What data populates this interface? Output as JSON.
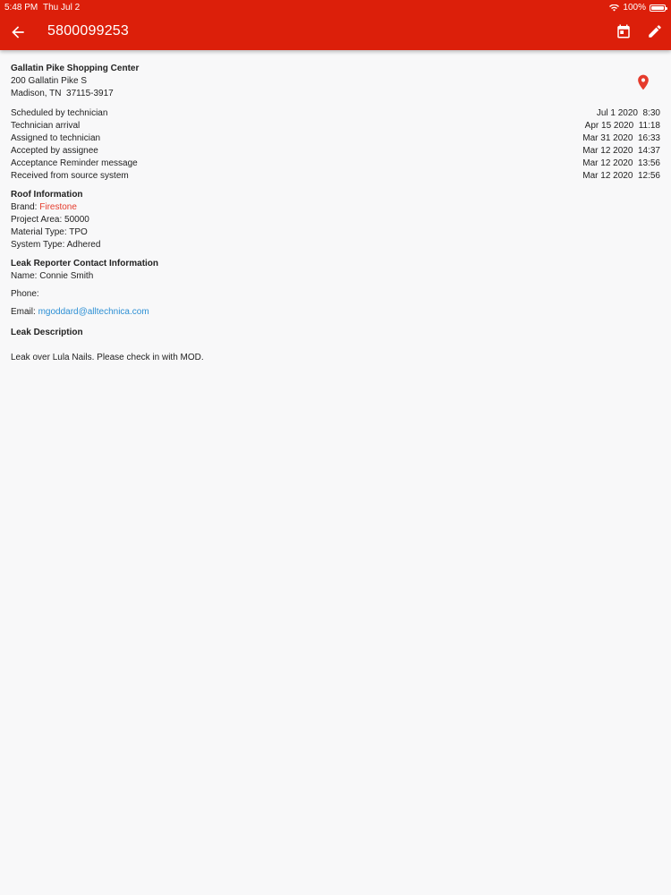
{
  "status_bar": {
    "time": "5:48 PM",
    "date": "Thu Jul 2",
    "battery": "100%"
  },
  "header": {
    "title": "5800099253"
  },
  "location": {
    "name": "Gallatin Pike Shopping Center",
    "address1": "200 Gallatin Pike S",
    "address2": "Madison, TN  37115-3917"
  },
  "timeline": [
    {
      "label": "Scheduled by technician",
      "value": "Jul 1 2020  8:30"
    },
    {
      "label": "Technician arrival",
      "value": "Apr 15 2020  11:18"
    },
    {
      "label": "Assigned to technician",
      "value": "Mar 31 2020  16:33"
    },
    {
      "label": "Accepted by assignee",
      "value": "Mar 12 2020  14:37"
    },
    {
      "label": "Acceptance Reminder message",
      "value": "Mar 12 2020  13:56"
    },
    {
      "label": "Received from source system",
      "value": "Mar 12 2020  12:56"
    }
  ],
  "roof": {
    "heading": "Roof Information",
    "brand_label": "Brand: ",
    "brand_value": "Firestone",
    "project_area": "Project Area: 50000",
    "material_type": "Material Type: TPO",
    "system_type": "System Type: Adhered"
  },
  "contact": {
    "heading": "Leak Reporter Contact Information",
    "name": "Name: Connie Smith",
    "phone": "Phone:",
    "email_label": "Email: ",
    "email_value": "mgoddard@alltechnica.com"
  },
  "leak": {
    "heading": "Leak Description",
    "text": "Leak over Lula Nails. Please check in with MOD."
  },
  "colors": {
    "appbar": "#dc1f0a",
    "accent": "#e53b2c",
    "link": "#2c8fd4"
  },
  "icons": {
    "back": "arrow-left-icon",
    "calendar": "calendar-icon",
    "edit": "pencil-icon",
    "map": "map-pin-icon",
    "wifi": "wifi-icon",
    "battery": "battery-icon"
  }
}
